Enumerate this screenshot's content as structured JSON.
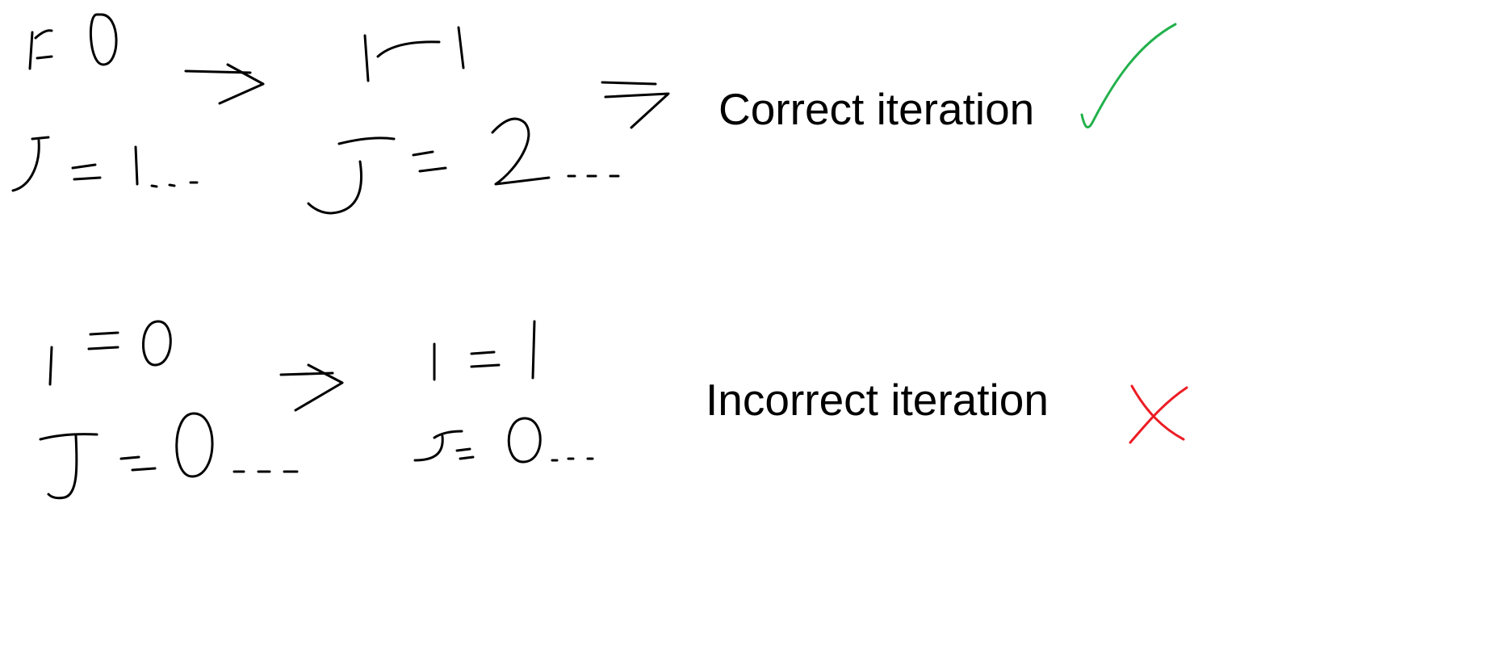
{
  "rows": [
    {
      "label": "Correct iteration",
      "mark": "check-icon",
      "mark_color": "#22b14c",
      "steps": [
        {
          "i": "i=0",
          "j": "j=1..."
        },
        {
          "i": "i=1",
          "j": "j=2..."
        }
      ]
    },
    {
      "label": "Incorrect iteration",
      "mark": "cross-icon",
      "mark_color": "#ed1c24",
      "steps": [
        {
          "i": "i=0",
          "j": "j=0..."
        },
        {
          "i": "i=1",
          "j": "j=0..."
        }
      ]
    }
  ],
  "ink_color": "#000000"
}
